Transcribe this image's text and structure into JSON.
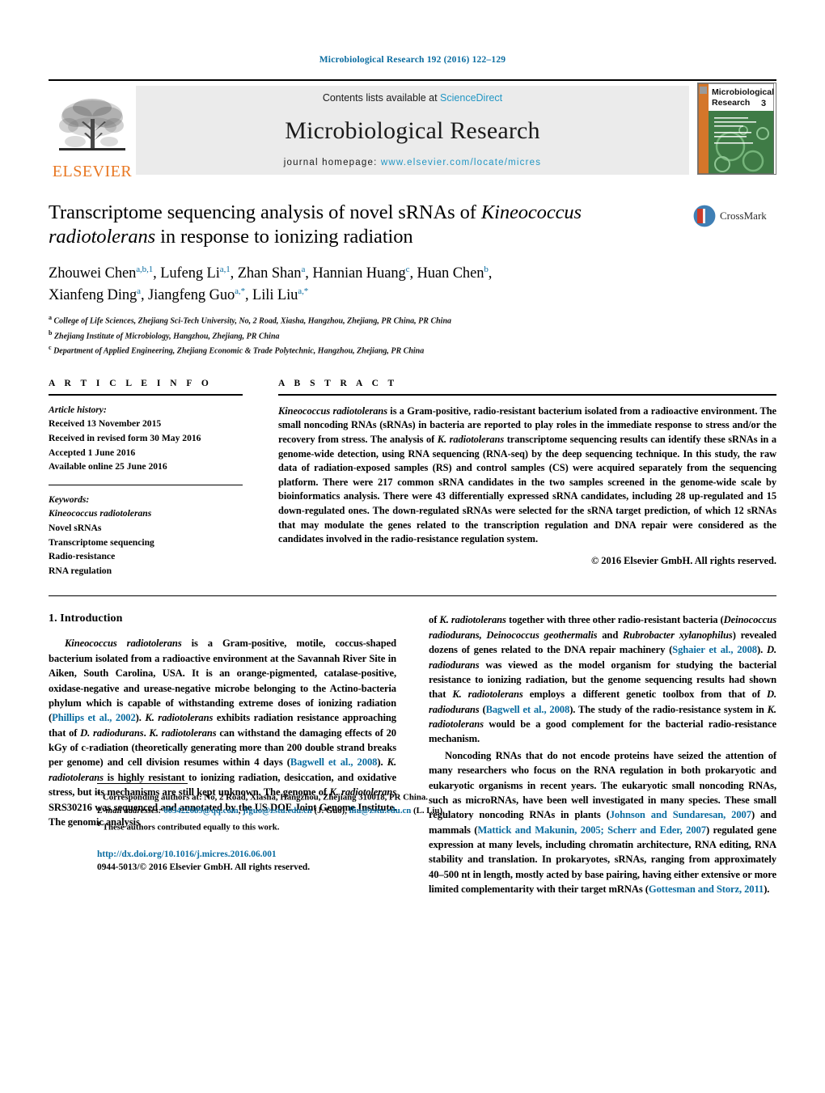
{
  "running_head": "Microbiological Research 192 (2016) 122–129",
  "masthead": {
    "publisher_name": "ELSEVIER",
    "contents_line_prefix": "Contents lists available at ",
    "contents_line_link": "ScienceDirect",
    "journal_title": "Microbiological Research",
    "homepage_label": "journal homepage:",
    "homepage_url": "www.elsevier.com/locate/micres",
    "cover": {
      "title_line1": "Microbiological",
      "title_line2": "Research",
      "issue_number": "3"
    }
  },
  "article": {
    "title_line1_a": "Transcriptome sequencing analysis of novel sRNAs of ",
    "title_line1_it": "Kineococcus",
    "title_line2_it": "radiotolerans",
    "title_line2_b": " in response to ionizing radiation",
    "crossmark_label": "CrossMark",
    "authors_line1": "Zhouwei Chen",
    "authors": [
      {
        "name": "Zhouwei Chen",
        "sup": "a,b,1"
      },
      {
        "name": "Lufeng Li",
        "sup": "a,1"
      },
      {
        "name": "Zhan Shan",
        "sup": "a"
      },
      {
        "name": "Hannian Huang",
        "sup": "c"
      },
      {
        "name": "Huan Chen",
        "sup": "b"
      },
      {
        "name": "Xianfeng Ding",
        "sup": "a"
      },
      {
        "name": "Jiangfeng Guo",
        "sup": "a,*"
      },
      {
        "name": "Lili Liu",
        "sup": "a,*"
      }
    ],
    "affiliations": [
      {
        "mark": "a",
        "text": "College of Life Sciences, Zhejiang Sci-Tech University, No, 2 Road, Xiasha, Hangzhou, Zhejiang, PR China, PR China"
      },
      {
        "mark": "b",
        "text": "Zhejiang Institute of Microbiology, Hangzhou, Zhejiang, PR China"
      },
      {
        "mark": "c",
        "text": "Department of Applied Engineering, Zhejiang Economic & Trade Polytechnic, Hangzhou, Zhejiang, PR China"
      }
    ]
  },
  "article_info": {
    "heading": "A R T I C L E   I N F O",
    "history_label": "Article history:",
    "history": [
      "Received 13 November 2015",
      "Received in revised form 30 May 2016",
      "Accepted 1 June 2016",
      "Available online 25 June 2016"
    ],
    "keywords_label": "Keywords:",
    "keywords": [
      "Kineococcus radiotolerans",
      "Novel sRNAs",
      "Transcriptome sequencing",
      "Radio-resistance",
      "RNA regulation"
    ]
  },
  "abstract": {
    "heading": "A B S T R A C T",
    "organism_italic": "Kineococcus radiotolerans",
    "text_part1": " is a Gram-positive, radio-resistant bacterium isolated from a radioactive environment. The small noncoding RNAs (sRNAs) in bacteria are reported to play roles in the immediate response to stress and/or the recovery from stress. The analysis of ",
    "organism_short_italic": "K. radiotolerans",
    "text_part2": " transcriptome sequencing results can identify these sRNAs in a genome-wide detection, using RNA sequencing (RNA-seq) by the deep sequencing technique. In this study, the raw data of radiation-exposed samples (RS) and control samples (CS) were acquired separately from the sequencing platform. There were 217 common sRNA candidates in the two samples screened in the genome-wide scale by bioinformatics analysis. There were 43 differentially expressed sRNA candidates, including 28 up-regulated and 15 down-regulated ones. The down-regulated sRNAs were selected for the sRNA target prediction, of which 12 sRNAs that may modulate the genes related to the transcription regulation and DNA repair were considered as the candidates involved in the radio-resistance regulation system.",
    "copyright": "© 2016 Elsevier GmbH. All rights reserved."
  },
  "introduction": {
    "heading": "1.  Introduction",
    "left_p1_organism": "Kineococcus radiotolerans",
    "left_p1_a": " is a Gram-positive, motile, coccus-shaped bacterium isolated from a radioactive environment at the Savannah River Site in Aiken, South Carolina, USA. It is an orange-pigmented, catalase-positive, oxidase-negative and urease-negative microbe belonging to the Actino-bacteria phylum which is capable of withstanding extreme doses of ionizing radiation (",
    "cite_phillips": "Phillips et al., 2002",
    "left_p1_b": "). ",
    "left_p1_kr1": "K. radiotolerans",
    "left_p1_c": " exhibits radiation resistance approaching that of ",
    "left_p1_dr": "D. radiodurans",
    "left_p1_d": ". ",
    "left_p1_kr2": "K. radiotolerans",
    "left_p1_e": " can withstand the damaging effects of 20 kGy of c-radiation (theoretically generating more than 200 double strand breaks per genome) and cell division resumes within 4 days (",
    "cite_bagwell_left": "Bagwell et al., 2008",
    "left_p1_f": "). ",
    "left_p1_kr3": "K. radiotolerans",
    "left_p1_g": " is highly resistant to ionizing radiation, desiccation, and oxidative stress, but its mechanisms are still kept unknown. The genome of ",
    "left_p1_kr4": "K. radiotolerans",
    "left_p1_h": " SRS30216 was sequenced and annotated by the US DOE Joint Genome Institute. The genomic analysis",
    "right_p1_a": "of ",
    "right_p1_kr": "K. radiotolerans",
    "right_p1_b": " together with three other radio-resistant bacteria (",
    "right_p1_sp1": "Deinococcus radiodurans, Deinococcus geothermalis",
    "right_p1_c": " and ",
    "right_p1_sp2": "Rubrobacter xylanophilus",
    "right_p1_d": ") revealed dozens of genes related to the DNA repair machinery (",
    "cite_sghaier": "Sghaier et al., 2008",
    "right_p1_e": "). ",
    "right_p1_dr": "D. radiodurans",
    "right_p1_f": " was viewed as the model organism for studying the bacterial resistance to ionizing radiation, but the genome sequencing results had shown that ",
    "right_p1_kr2": "K. radiotolerans",
    "right_p1_g": " employs a different genetic toolbox from that of ",
    "right_p1_dr2": "D. radiodurans",
    "right_p1_h": " (",
    "cite_bagwell_right": "Bagwell et al., 2008",
    "right_p1_i": "). The study of the radio-resistance system in ",
    "right_p1_kr3": "K. radiotolerans",
    "right_p1_j": " would be a good complement for the bacterial radio-resistance mechanism.",
    "right_p2_a": "Noncoding RNAs that do not encode proteins have seized the attention of many researchers who focus on the RNA regulation in both prokaryotic and eukaryotic organisms in recent years. The eukaryotic small noncoding RNAs, such as microRNAs, have been well investigated in many species. These small regulatory noncoding RNAs in plants (",
    "cite_johnson": "Johnson and Sundaresan, 2007",
    "right_p2_b": ") and mammals (",
    "cite_mattick": "Mattick and Makunin, 2005; Scherr and Eder, 2007",
    "right_p2_c": ") regulated gene expression at many levels, including chromatin architecture, RNA editing, RNA stability and translation. In prokaryotes, sRNAs, ranging from approximately 40–500 nt in length, mostly acted by base pairing, having either extensive or more limited complementarity with their target mRNAs (",
    "cite_gottesman": "Gottesman and Storz, 2011",
    "right_p2_d": ")."
  },
  "footnotes": {
    "corresponding_mark": "*",
    "corresponding_text": "Corresponding authors at: No, 2 Road, Xiasha, Hangzhou, Zhejiang 310018, PR China.",
    "email_label": "E-mail addresses:",
    "email1": "603422689@qq.com",
    "email2": "jfguo@zstu.edu.cn",
    "email2_owner": "(J. Guo),",
    "email3": "lliu@zstu.edu.cn",
    "email3_owner": "(L. Liu).",
    "equal_mark": "1",
    "equal_text": "These authors contributed equally to this work.",
    "doi": "http://dx.doi.org/10.1016/j.micres.2016.06.001",
    "issn_line": "0944-5013/© 2016 Elsevier GmbH. All rights reserved."
  }
}
